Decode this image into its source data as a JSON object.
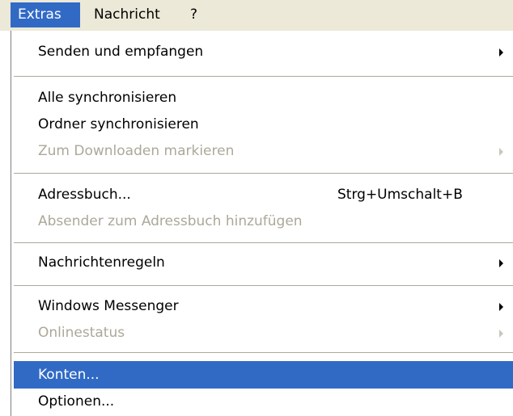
{
  "menubar": {
    "items": [
      {
        "label": "Extras"
      },
      {
        "label": "Nachricht"
      },
      {
        "label": "?"
      }
    ]
  },
  "menu": {
    "items": [
      {
        "label": "Senden und empfangen",
        "enabled": true,
        "has_submenu": true
      },
      {
        "label": "Alle synchronisieren",
        "enabled": true
      },
      {
        "label": "Ordner synchronisieren",
        "enabled": true
      },
      {
        "label": "Zum Downloaden markieren",
        "enabled": false,
        "has_submenu": true
      },
      {
        "label": "Adressbuch...",
        "shortcut": "Strg+Umschalt+B",
        "enabled": true
      },
      {
        "label": "Absender zum Adressbuch hinzufügen",
        "enabled": false
      },
      {
        "label": "Nachrichtenregeln",
        "enabled": true,
        "has_submenu": true
      },
      {
        "label": "Windows Messenger",
        "enabled": true,
        "has_submenu": true
      },
      {
        "label": "Onlinestatus",
        "enabled": false,
        "has_submenu": true
      },
      {
        "label": "Konten...",
        "enabled": true,
        "highlighted": true
      },
      {
        "label": "Optionen...",
        "enabled": true
      }
    ]
  },
  "colors": {
    "highlight": "#316ac5",
    "disabled_text": "#aca899",
    "menubar_bg": "#ece9d8"
  }
}
